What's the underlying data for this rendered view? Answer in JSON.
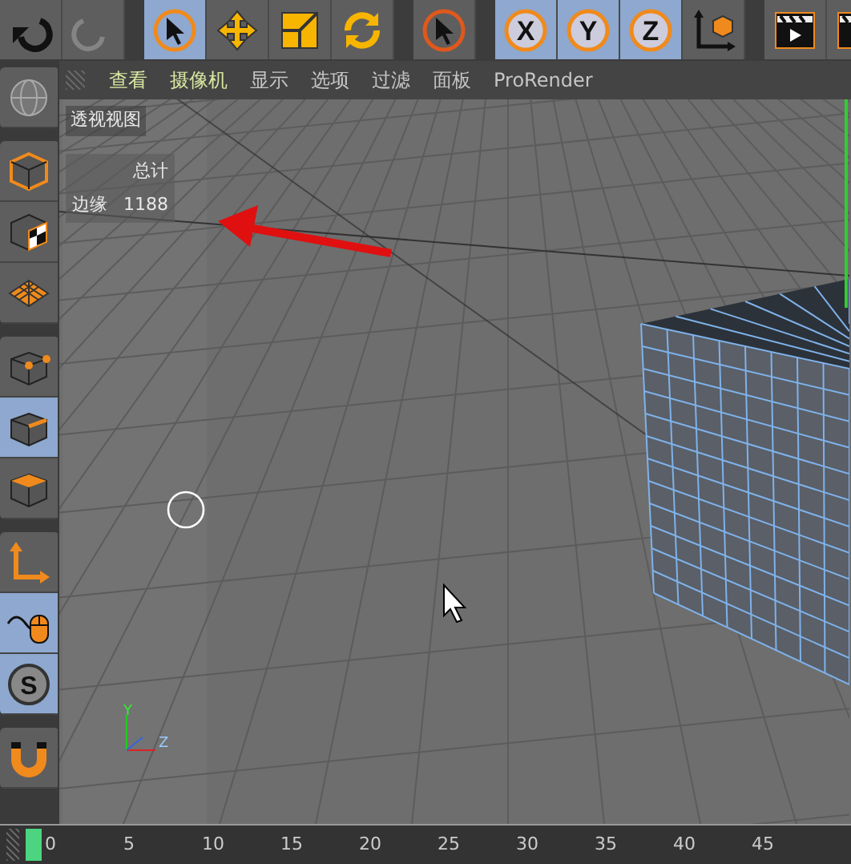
{
  "toolbar": [
    [
      {
        "kind": "undo",
        "selected": false,
        "disabled": false
      },
      {
        "kind": "redo",
        "selected": false,
        "disabled": true
      }
    ],
    [
      {
        "kind": "select",
        "selected": true,
        "disabled": false
      },
      {
        "kind": "move",
        "selected": false,
        "disabled": false
      },
      {
        "kind": "scale",
        "selected": false,
        "disabled": false
      },
      {
        "kind": "rotate",
        "selected": false,
        "disabled": false
      }
    ],
    [
      {
        "kind": "live-select",
        "selected": false,
        "disabled": false
      }
    ],
    [
      {
        "kind": "axis-lock",
        "label": "X",
        "selected": true,
        "disabled": false
      },
      {
        "kind": "axis-lock",
        "label": "Y",
        "selected": true,
        "disabled": false
      },
      {
        "kind": "axis-lock",
        "label": "Z",
        "selected": true,
        "disabled": false
      },
      {
        "kind": "coords",
        "selected": false,
        "disabled": false
      }
    ],
    [
      {
        "kind": "render",
        "selected": false,
        "disabled": false
      },
      {
        "kind": "render",
        "selected": false,
        "disabled": false
      }
    ]
  ],
  "menu": [
    {
      "label": "查看",
      "highlighted": true
    },
    {
      "label": "摄像机",
      "highlighted": true
    },
    {
      "label": "显示",
      "highlighted": false
    },
    {
      "label": "选项",
      "highlighted": false
    },
    {
      "label": "过滤",
      "highlighted": false
    },
    {
      "label": "面板",
      "highlighted": false
    },
    {
      "label": "ProRender",
      "highlighted": false
    }
  ],
  "tools": [
    [
      {
        "kind": "sphere",
        "selected": false
      }
    ],
    [
      {
        "kind": "cube",
        "selected": false
      },
      {
        "kind": "texture",
        "selected": false
      },
      {
        "kind": "workplane",
        "selected": false
      }
    ],
    [
      {
        "kind": "points",
        "selected": false
      },
      {
        "kind": "edges",
        "selected": true
      },
      {
        "kind": "polygons",
        "selected": false
      }
    ],
    [
      {
        "kind": "axis",
        "selected": false
      },
      {
        "kind": "tweak",
        "selected": true
      },
      {
        "kind": "snap",
        "label": "S",
        "selected": true
      }
    ],
    [
      {
        "kind": "magnet",
        "selected": false
      }
    ]
  ],
  "viewport": {
    "title": "透视视图",
    "stats": {
      "header": "总计",
      "label": "边缘",
      "value": "1188"
    },
    "axis_labels": [
      "Y",
      "Z"
    ]
  },
  "timeline": {
    "level": 0,
    "ticks": [
      "0",
      "5",
      "10",
      "15",
      "20",
      "25",
      "30",
      "35",
      "40",
      "45"
    ]
  }
}
